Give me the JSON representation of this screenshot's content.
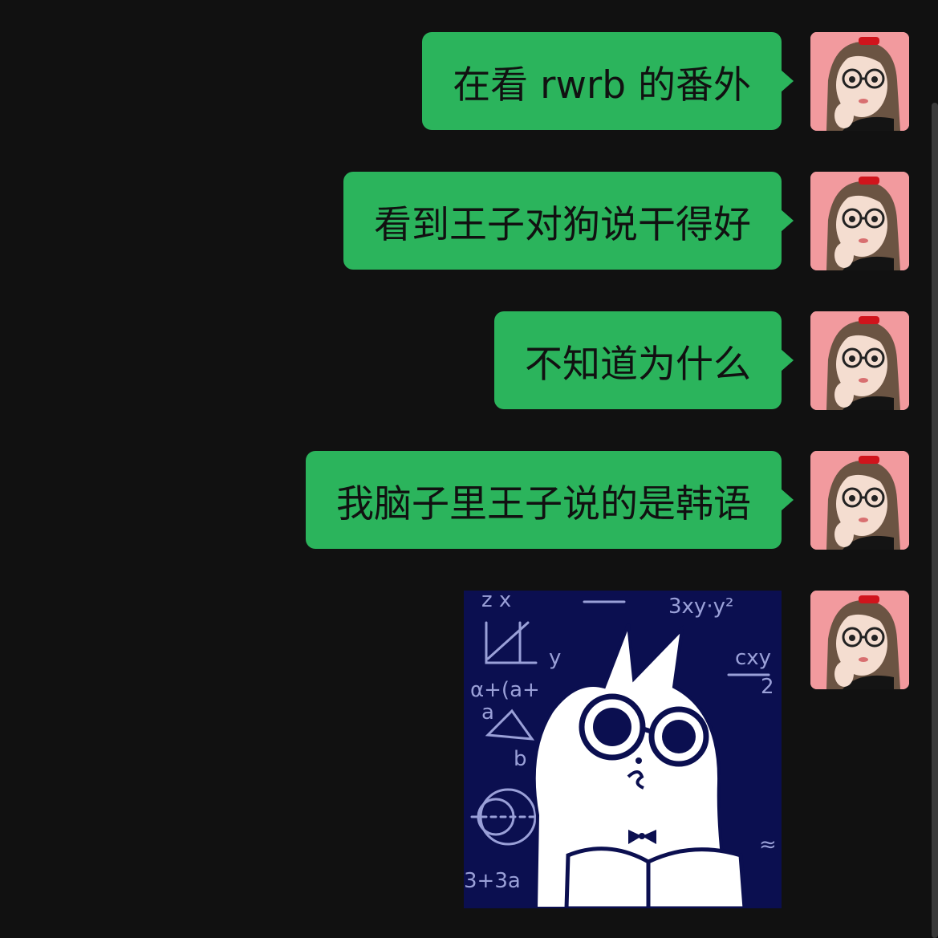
{
  "messages": [
    {
      "type": "text",
      "text": "在看 rwrb 的番外"
    },
    {
      "type": "text",
      "text": "看到王子对狗说干得好"
    },
    {
      "type": "text",
      "text": "不知道为什么"
    },
    {
      "type": "text",
      "text": "我脑子里王子说的是韩语"
    },
    {
      "type": "sticker",
      "sticker": "cat-with-glasses-reading-book-sticker"
    }
  ],
  "sticker_text": {
    "eq1": "z  x",
    "eq2": "3xy·y²",
    "eq3": "cxy",
    "eq4": "2",
    "eq5": "α+(a+",
    "eq6": "a",
    "eq7": "b",
    "eq8": "y",
    "eq9": "3+3a",
    "eq10": "≈"
  },
  "colors": {
    "background": "#111111",
    "bubble": "#2bb45c",
    "avatar_bg": "#f29a9e",
    "sticker_bg": "#0b0f50"
  }
}
